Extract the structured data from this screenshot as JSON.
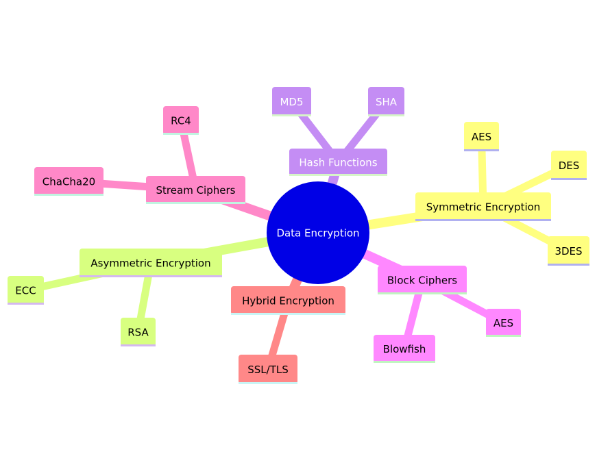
{
  "diagram": {
    "type": "mindmap",
    "root": {
      "label": "Data Encryption",
      "color": "#0000e6",
      "text_color": "#ffffff"
    },
    "branches": [
      {
        "label": "Hash Functions",
        "color": "#c48df4",
        "underline": "#d6f5c8",
        "text_color": "#ffffff",
        "children": [
          {
            "label": "MD5"
          },
          {
            "label": "SHA"
          }
        ]
      },
      {
        "label": "Symmetric Encryption",
        "color": "#ffff80",
        "underline": "#b0b0f0",
        "text_color": "#000000",
        "children": [
          {
            "label": "AES"
          },
          {
            "label": "DES"
          },
          {
            "label": "3DES"
          }
        ]
      },
      {
        "label": "Block Ciphers",
        "color": "#ff88ff",
        "underline": "#c0f5c0",
        "text_color": "#000000",
        "children": [
          {
            "label": "AES"
          },
          {
            "label": "Blowfish"
          }
        ]
      },
      {
        "label": "Hybrid Encryption",
        "color": "#ff8888",
        "underline": "#c8f5f5",
        "text_color": "#000000",
        "children": [
          {
            "label": "SSL/TLS"
          }
        ]
      },
      {
        "label": "Asymmetric Encryption",
        "color": "#d8ff80",
        "underline": "#d4b8f0",
        "text_color": "#000000",
        "children": [
          {
            "label": "ECC"
          },
          {
            "label": "RSA"
          }
        ]
      },
      {
        "label": "Stream Ciphers",
        "color": "#ff88c8",
        "underline": "#c0f5e0",
        "text_color": "#000000",
        "children": [
          {
            "label": "RC4"
          },
          {
            "label": "ChaCha20"
          }
        ]
      }
    ]
  }
}
